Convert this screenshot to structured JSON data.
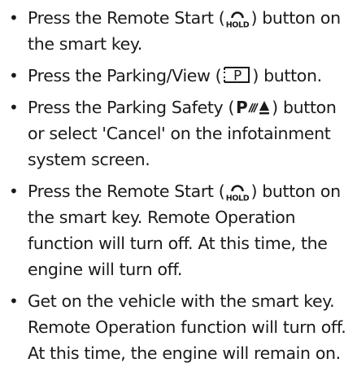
{
  "bullet_glyph": "•",
  "items": [
    {
      "before": "Press the Remote Start (",
      "icon": "remote-start-icon",
      "after": ") button on the smart key."
    },
    {
      "before": "Press the Parking/View (",
      "icon": "parking-view-icon",
      "after": ") button."
    },
    {
      "before": "Press the Parking Safety (",
      "icon": "parking-safety-icon",
      "after": ") button or select 'Cancel' on the infotainment system screen."
    },
    {
      "before": "Press the Remote Start (",
      "icon": "remote-start-icon",
      "after": ") button on the smart key. Remote Operation function will turn off. At this time, the engine will turn off."
    },
    {
      "text": "Get on the vehicle with the smart key. Remote Operation function will turn off. At this time, the engine will remain on."
    }
  ],
  "icon_labels": {
    "remote_hold": "HOLD",
    "park_letter": "P"
  }
}
